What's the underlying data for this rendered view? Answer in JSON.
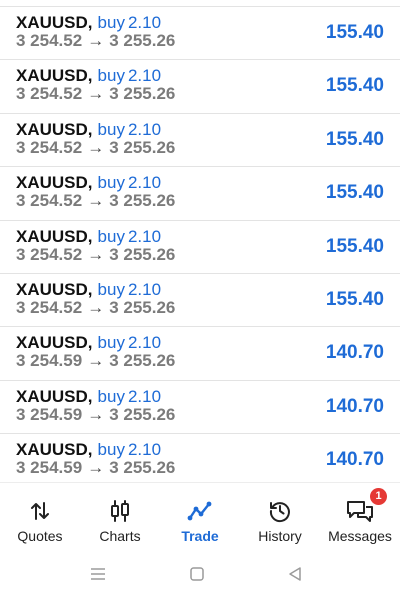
{
  "trades": [
    {
      "symbol": "XAUUSD",
      "side": "buy",
      "volume": "2.10",
      "open_price": "3 254.52",
      "arrow": "→",
      "current_price": "3 255.26",
      "profit": "155.40"
    },
    {
      "symbol": "XAUUSD",
      "side": "buy",
      "volume": "2.10",
      "open_price": "3 254.52",
      "arrow": "→",
      "current_price": "3 255.26",
      "profit": "155.40"
    },
    {
      "symbol": "XAUUSD",
      "side": "buy",
      "volume": "2.10",
      "open_price": "3 254.52",
      "arrow": "→",
      "current_price": "3 255.26",
      "profit": "155.40"
    },
    {
      "symbol": "XAUUSD",
      "side": "buy",
      "volume": "2.10",
      "open_price": "3 254.52",
      "arrow": "→",
      "current_price": "3 255.26",
      "profit": "155.40"
    },
    {
      "symbol": "XAUUSD",
      "side": "buy",
      "volume": "2.10",
      "open_price": "3 254.52",
      "arrow": "→",
      "current_price": "3 255.26",
      "profit": "155.40"
    },
    {
      "symbol": "XAUUSD",
      "side": "buy",
      "volume": "2.10",
      "open_price": "3 254.52",
      "arrow": "→",
      "current_price": "3 255.26",
      "profit": "155.40"
    },
    {
      "symbol": "XAUUSD",
      "side": "buy",
      "volume": "2.10",
      "open_price": "3 254.59",
      "arrow": "→",
      "current_price": "3 255.26",
      "profit": "140.70"
    },
    {
      "symbol": "XAUUSD",
      "side": "buy",
      "volume": "2.10",
      "open_price": "3 254.59",
      "arrow": "→",
      "current_price": "3 255.26",
      "profit": "140.70"
    },
    {
      "symbol": "XAUUSD",
      "side": "buy",
      "volume": "2.10",
      "open_price": "3 254.59",
      "arrow": "→",
      "current_price": "3 255.26",
      "profit": "140.70"
    }
  ],
  "nav": {
    "quotes": {
      "label": "Quotes",
      "icon": "quotes-arrows-icon"
    },
    "charts": {
      "label": "Charts",
      "icon": "candlestick-icon"
    },
    "trade": {
      "label": "Trade",
      "icon": "trade-line-icon",
      "active": true
    },
    "history": {
      "label": "History",
      "icon": "history-clock-icon"
    },
    "messages": {
      "label": "Messages",
      "icon": "messages-icon",
      "badge": "1"
    }
  },
  "system_nav": {
    "buttons": [
      "menu-icon",
      "home-icon",
      "back-icon"
    ]
  },
  "colors": {
    "accent": "#1e6bd6",
    "symbol": "#111111",
    "price": "#7b7b7b",
    "badge": "#e53935",
    "divider": "#e3e3e3"
  }
}
